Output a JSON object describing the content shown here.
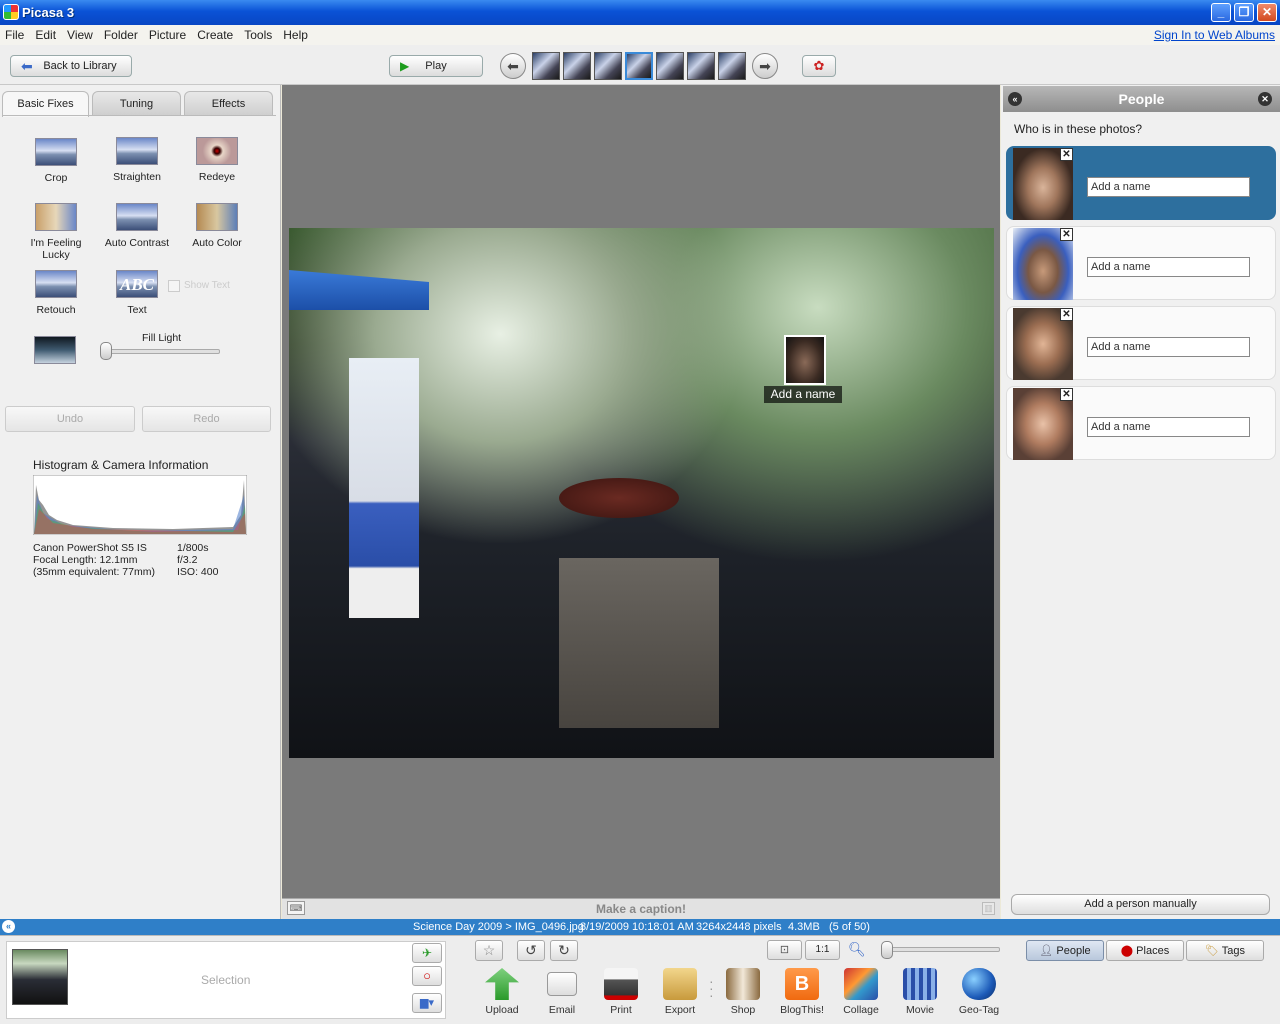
{
  "window": {
    "title": "Picasa 3"
  },
  "menu": [
    "File",
    "Edit",
    "View",
    "Folder",
    "Picture",
    "Create",
    "Tools",
    "Help"
  ],
  "signin": "Sign In to Web Albums",
  "toolbar": {
    "back": "Back to Library",
    "play": "Play"
  },
  "tabs": [
    "Basic Fixes",
    "Tuning",
    "Effects"
  ],
  "tools": [
    [
      "Crop",
      "Straighten",
      "Redeye"
    ],
    [
      "I'm Feeling Lucky",
      "Auto Contrast",
      "Auto Color"
    ],
    [
      "Retouch",
      "Text"
    ]
  ],
  "show_text": "Show Text",
  "fill_light": {
    "label": "Fill Light",
    "value": 0.0
  },
  "undo": "Undo",
  "redo": "Redo",
  "histogram": {
    "title": "Histogram & Camera Information",
    "camera": "Canon PowerShot S5 IS",
    "focal": "Focal Length: 12.1mm",
    "equiv": "(35mm equivalent:  77mm)",
    "shutter": "1/800s",
    "aperture": "f/3.2",
    "iso": "ISO: 400"
  },
  "photo_tag": "Add a name",
  "caption": "Make a caption!",
  "people": {
    "title": "People",
    "question": "Who is in these photos?",
    "placeholder": "Add a name",
    "add_manual": "Add a person manually",
    "count": 4
  },
  "status": {
    "path": "Science Day 2009 > IMG_0496.jpg",
    "date": "8/19/2009 10:18:01 AM",
    "dims": "3264x2448 pixels",
    "size": "4.3MB",
    "pos": "(5 of 50)"
  },
  "selection": "Selection",
  "actions": [
    "Upload",
    "Email",
    "Print",
    "Export",
    "Shop",
    "BlogThis!",
    "Collage",
    "Movie",
    "Geo-Tag"
  ],
  "view_tabs": [
    "People",
    "Places",
    "Tags"
  ],
  "one_to_one": "1:1"
}
